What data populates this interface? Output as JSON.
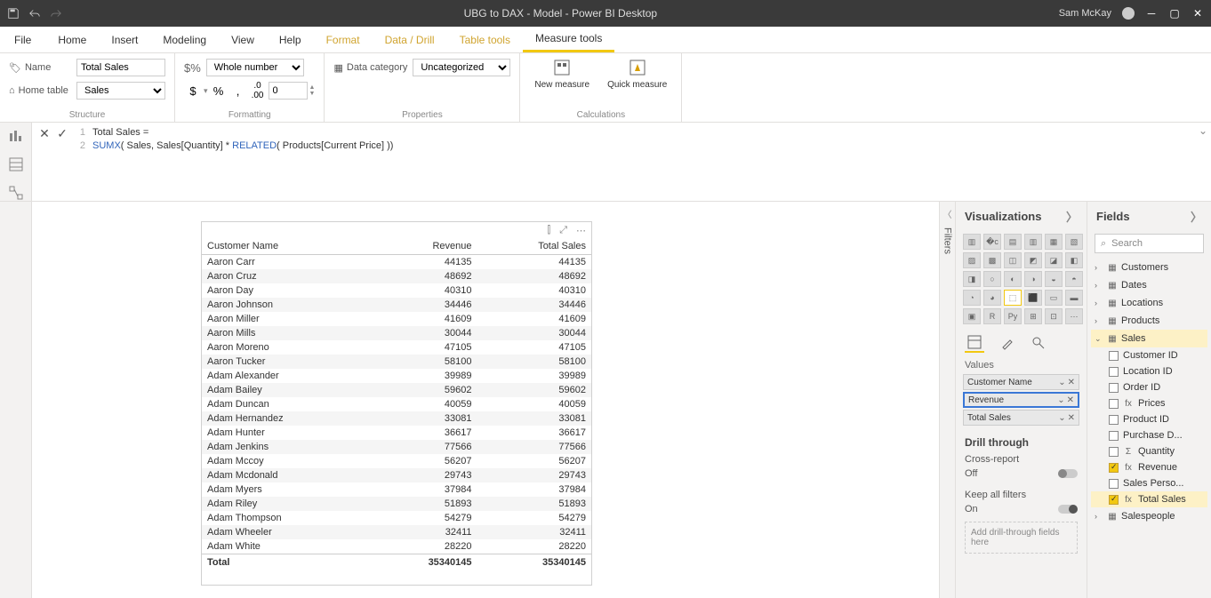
{
  "titlebar": {
    "title": "UBG to DAX - Model - Power BI Desktop",
    "user": "Sam McKay"
  },
  "tabs": {
    "file": "File",
    "home": "Home",
    "insert": "Insert",
    "modeling": "Modeling",
    "view": "View",
    "help": "Help",
    "format": "Format",
    "datadrill": "Data / Drill",
    "tabletools": "Table tools",
    "measuretools": "Measure tools"
  },
  "ribbon": {
    "structure": {
      "name_label": "Name",
      "name_value": "Total Sales",
      "hometable_label": "Home table",
      "hometable_value": "Sales",
      "group": "Structure"
    },
    "formatting": {
      "format_value": "Whole number",
      "decimals_value": "0",
      "group": "Formatting"
    },
    "properties": {
      "datacat_label": "Data category",
      "datacat_value": "Uncategorized",
      "group": "Properties"
    },
    "calculations": {
      "new_measure": "New measure",
      "quick_measure": "Quick measure",
      "group": "Calculations"
    }
  },
  "formula": {
    "line1": "Total Sales =",
    "line2_pre": "SUMX",
    "line2_args1": "( Sales, Sales[Quantity] * ",
    "line2_fn": "RELATED",
    "line2_args2": "( Products[Current Price] ))"
  },
  "table": {
    "columns": [
      "Customer Name",
      "Revenue",
      "Total Sales"
    ],
    "rows": [
      [
        "Aaron Carr",
        "44135",
        "44135"
      ],
      [
        "Aaron Cruz",
        "48692",
        "48692"
      ],
      [
        "Aaron Day",
        "40310",
        "40310"
      ],
      [
        "Aaron Johnson",
        "34446",
        "34446"
      ],
      [
        "Aaron Miller",
        "41609",
        "41609"
      ],
      [
        "Aaron Mills",
        "30044",
        "30044"
      ],
      [
        "Aaron Moreno",
        "47105",
        "47105"
      ],
      [
        "Aaron Tucker",
        "58100",
        "58100"
      ],
      [
        "Adam Alexander",
        "39989",
        "39989"
      ],
      [
        "Adam Bailey",
        "59602",
        "59602"
      ],
      [
        "Adam Duncan",
        "40059",
        "40059"
      ],
      [
        "Adam Hernandez",
        "33081",
        "33081"
      ],
      [
        "Adam Hunter",
        "36617",
        "36617"
      ],
      [
        "Adam Jenkins",
        "77566",
        "77566"
      ],
      [
        "Adam Mccoy",
        "56207",
        "56207"
      ],
      [
        "Adam Mcdonald",
        "29743",
        "29743"
      ],
      [
        "Adam Myers",
        "37984",
        "37984"
      ],
      [
        "Adam Riley",
        "51893",
        "51893"
      ],
      [
        "Adam Thompson",
        "54279",
        "54279"
      ],
      [
        "Adam Wheeler",
        "32411",
        "32411"
      ],
      [
        "Adam White",
        "28220",
        "28220"
      ]
    ],
    "total_label": "Total",
    "total_rev": "35340145",
    "total_ts": "35340145"
  },
  "filters": {
    "label": "Filters"
  },
  "viz": {
    "title": "Visualizations",
    "values_label": "Values",
    "wells": [
      "Customer Name",
      "Revenue",
      "Total Sales"
    ],
    "drill_title": "Drill through",
    "cross_report": "Cross-report",
    "off": "Off",
    "keep_filters": "Keep all filters",
    "on": "On",
    "drop_hint": "Add drill-through fields here"
  },
  "fields": {
    "title": "Fields",
    "search": "Search",
    "tables": [
      {
        "name": "Customers",
        "open": false
      },
      {
        "name": "Dates",
        "open": false
      },
      {
        "name": "Locations",
        "open": false
      },
      {
        "name": "Products",
        "open": false
      },
      {
        "name": "Sales",
        "open": true,
        "fields": [
          {
            "name": "Customer ID",
            "checked": false,
            "icon": ""
          },
          {
            "name": "Location ID",
            "checked": false,
            "icon": ""
          },
          {
            "name": "Order ID",
            "checked": false,
            "icon": ""
          },
          {
            "name": "Prices",
            "checked": false,
            "icon": "fx"
          },
          {
            "name": "Product ID",
            "checked": false,
            "icon": ""
          },
          {
            "name": "Purchase D...",
            "checked": false,
            "icon": ""
          },
          {
            "name": "Quantity",
            "checked": false,
            "icon": "Σ"
          },
          {
            "name": "Revenue",
            "checked": true,
            "icon": "fx"
          },
          {
            "name": "Sales Perso...",
            "checked": false,
            "icon": ""
          },
          {
            "name": "Total Sales",
            "checked": true,
            "icon": "fx",
            "hl": true
          }
        ]
      },
      {
        "name": "Salespeople",
        "open": false
      }
    ]
  }
}
